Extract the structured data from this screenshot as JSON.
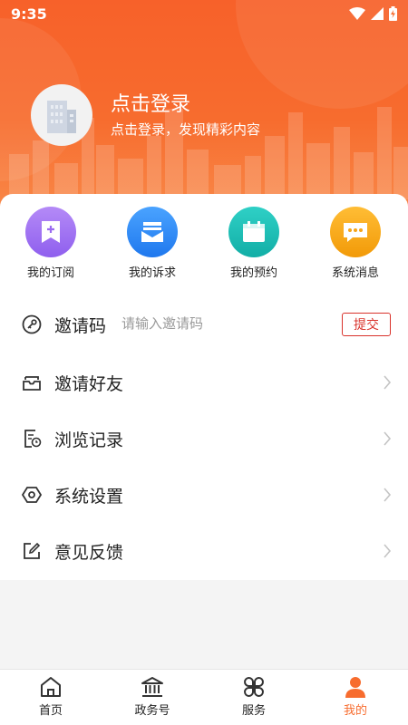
{
  "status_bar": {
    "time": "9:35"
  },
  "header": {
    "login_title": "点击登录",
    "login_subtitle": "点击登录，发现精彩内容"
  },
  "quick_actions": [
    {
      "label": "我的订阅",
      "icon": "bookmark-plus-icon",
      "color": "#9b6bf0"
    },
    {
      "label": "我的诉求",
      "icon": "mail-icon",
      "color": "#2a86f4"
    },
    {
      "label": "我的预约",
      "icon": "calendar-icon",
      "color": "#1cbcb4"
    },
    {
      "label": "系统消息",
      "icon": "message-icon",
      "color": "#f6a519"
    }
  ],
  "invite": {
    "label": "邀请码",
    "placeholder": "请输入邀请码",
    "submit_label": "提交"
  },
  "menu": [
    {
      "label": "邀请好友",
      "icon": "inbox-icon"
    },
    {
      "label": "浏览记录",
      "icon": "history-icon"
    },
    {
      "label": "系统设置",
      "icon": "settings-icon"
    },
    {
      "label": "意见反馈",
      "icon": "edit-icon"
    }
  ],
  "bottom_nav": [
    {
      "label": "首页",
      "icon": "home-icon",
      "active": false
    },
    {
      "label": "政务号",
      "icon": "government-icon",
      "active": false
    },
    {
      "label": "服务",
      "icon": "services-icon",
      "active": false
    },
    {
      "label": "我的",
      "icon": "profile-icon",
      "active": true
    }
  ],
  "colors": {
    "brand": "#f76c2e",
    "accent_red": "#d9322b"
  }
}
